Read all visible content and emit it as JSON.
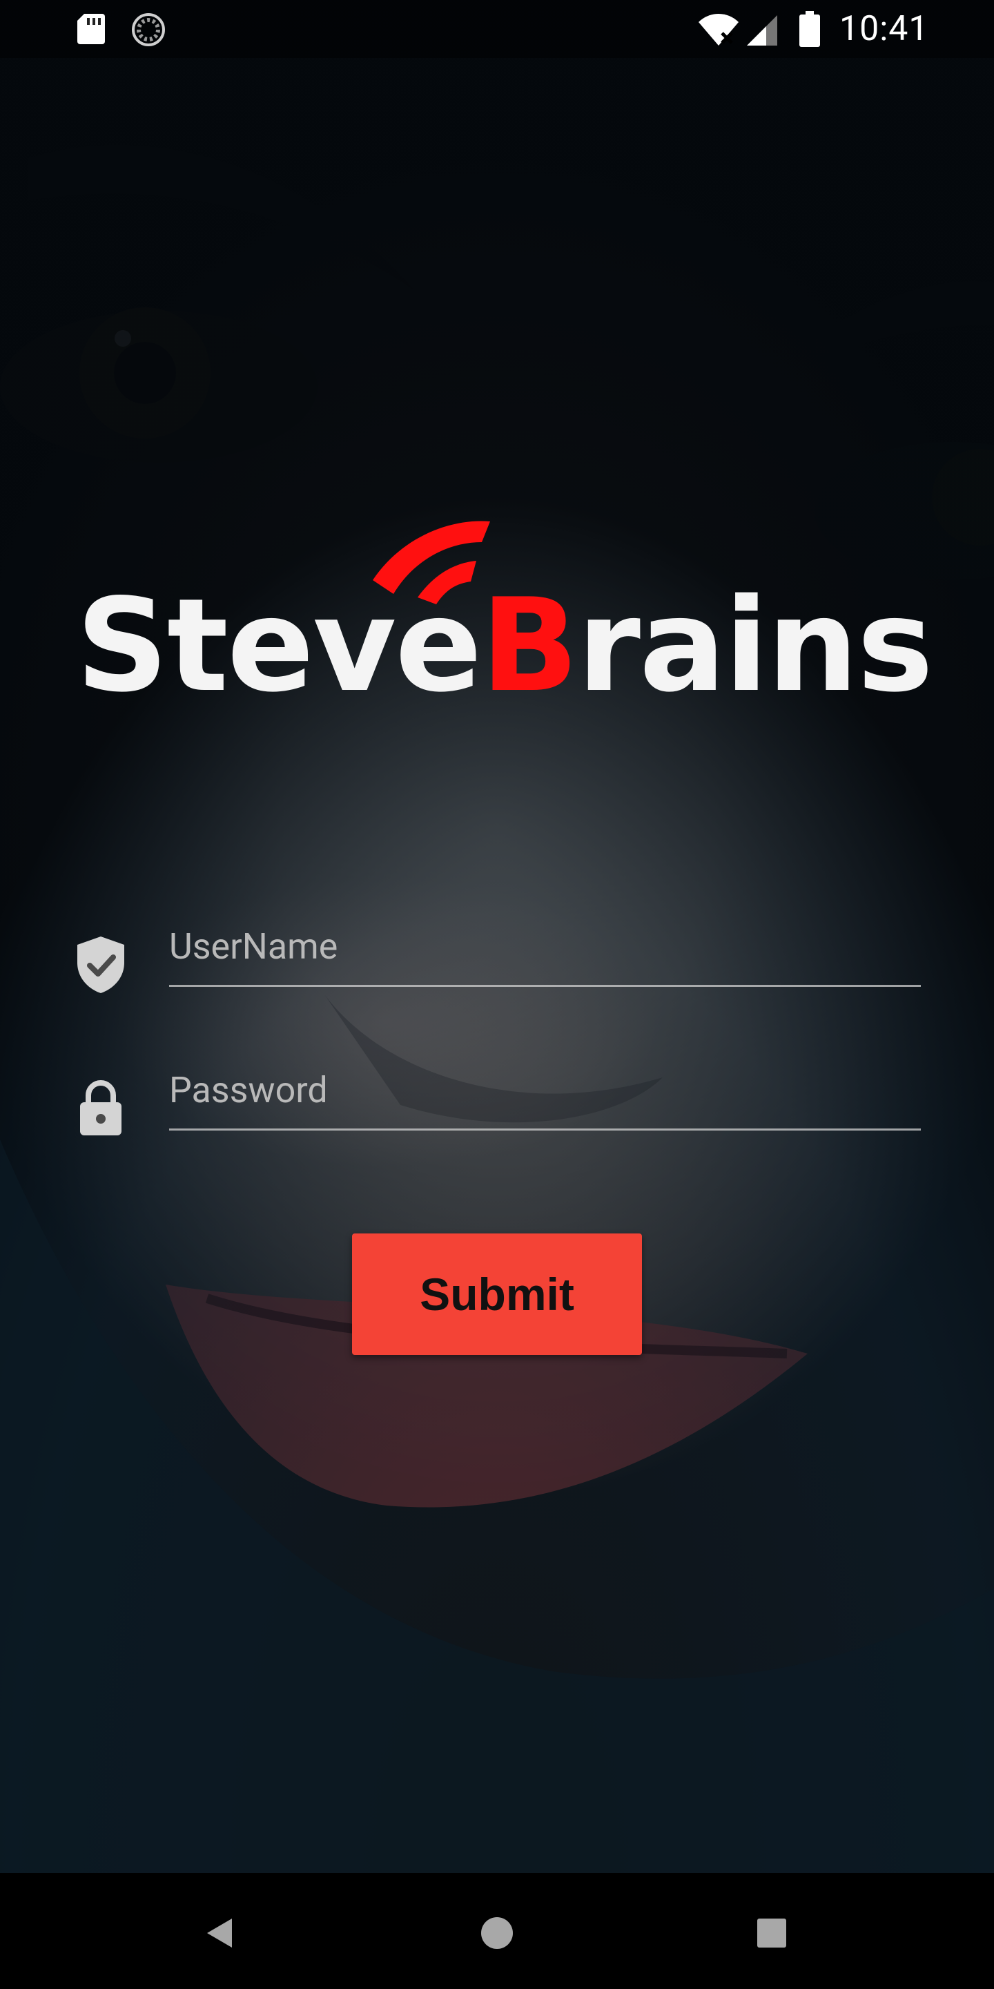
{
  "status_bar": {
    "time": "10:41",
    "icons": [
      "sd-card-icon",
      "sync-icon",
      "wifi-off-icon",
      "cell-signal-icon",
      "battery-icon"
    ]
  },
  "logo": {
    "text_prefix": "Steve",
    "text_accent": "B",
    "text_suffix": "rains",
    "accent_color": "#ff1010"
  },
  "form": {
    "username": {
      "placeholder": "UserName",
      "value": "",
      "icon": "shield-check-icon"
    },
    "password": {
      "placeholder": "Password",
      "value": "",
      "icon": "lock-icon"
    },
    "submit_label": "Submit",
    "submit_color": "#f44336"
  },
  "nav_bar": {
    "buttons": [
      "back-icon",
      "home-icon",
      "recents-icon"
    ]
  }
}
